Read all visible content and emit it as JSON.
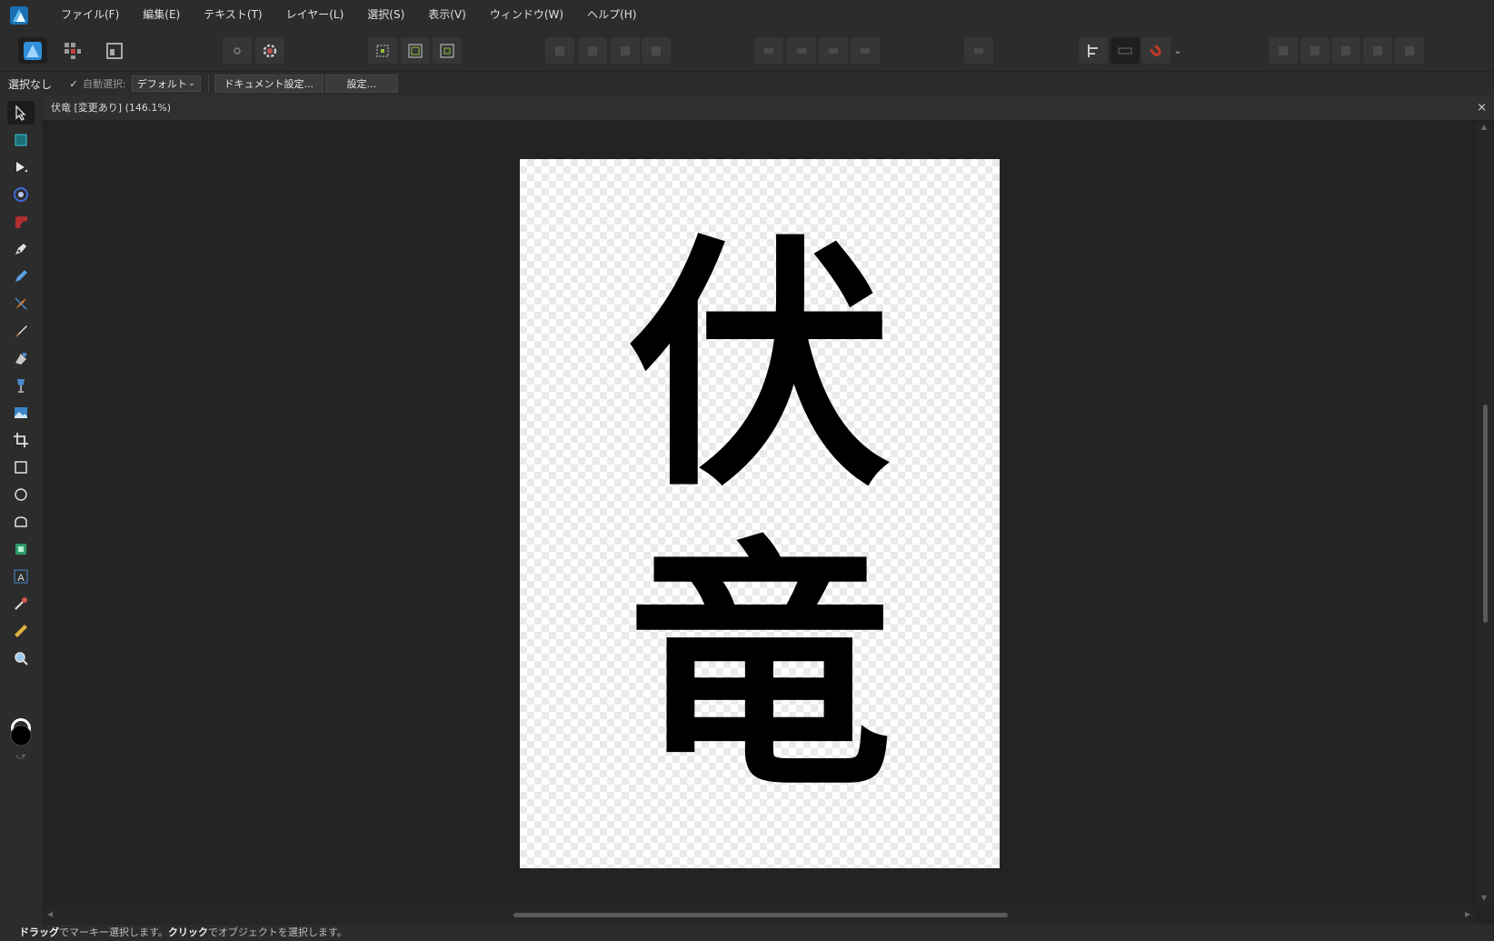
{
  "menu": [
    "ファイル(F)",
    "編集(E)",
    "テキスト(T)",
    "レイヤー(L)",
    "選択(S)",
    "表示(V)",
    "ウィンドウ(W)",
    "ヘルプ(H)"
  ],
  "context_bar": {
    "selection_label": "選択なし",
    "auto_select_label": "自動選択:",
    "auto_select_value": "デフォルト",
    "document_setup_button": "ドキュメント設定...",
    "settings_button": "設定..."
  },
  "document": {
    "tab_title": "伏竜 [変更あり] (146.1%)",
    "close_glyph": "×",
    "artboard_text": "伏竜"
  },
  "status": {
    "drag_bold": "ドラッグ",
    "drag_text": "でマーキー選択します。",
    "click_bold": "クリック",
    "click_text": "でオブジェクトを選択します。"
  },
  "colors": {
    "accent_blue": "#2f8fd8",
    "magnet_red": "#c0392b",
    "ink": "#000000",
    "ui_background": "#232323",
    "panel_background": "#2c2c2c"
  }
}
